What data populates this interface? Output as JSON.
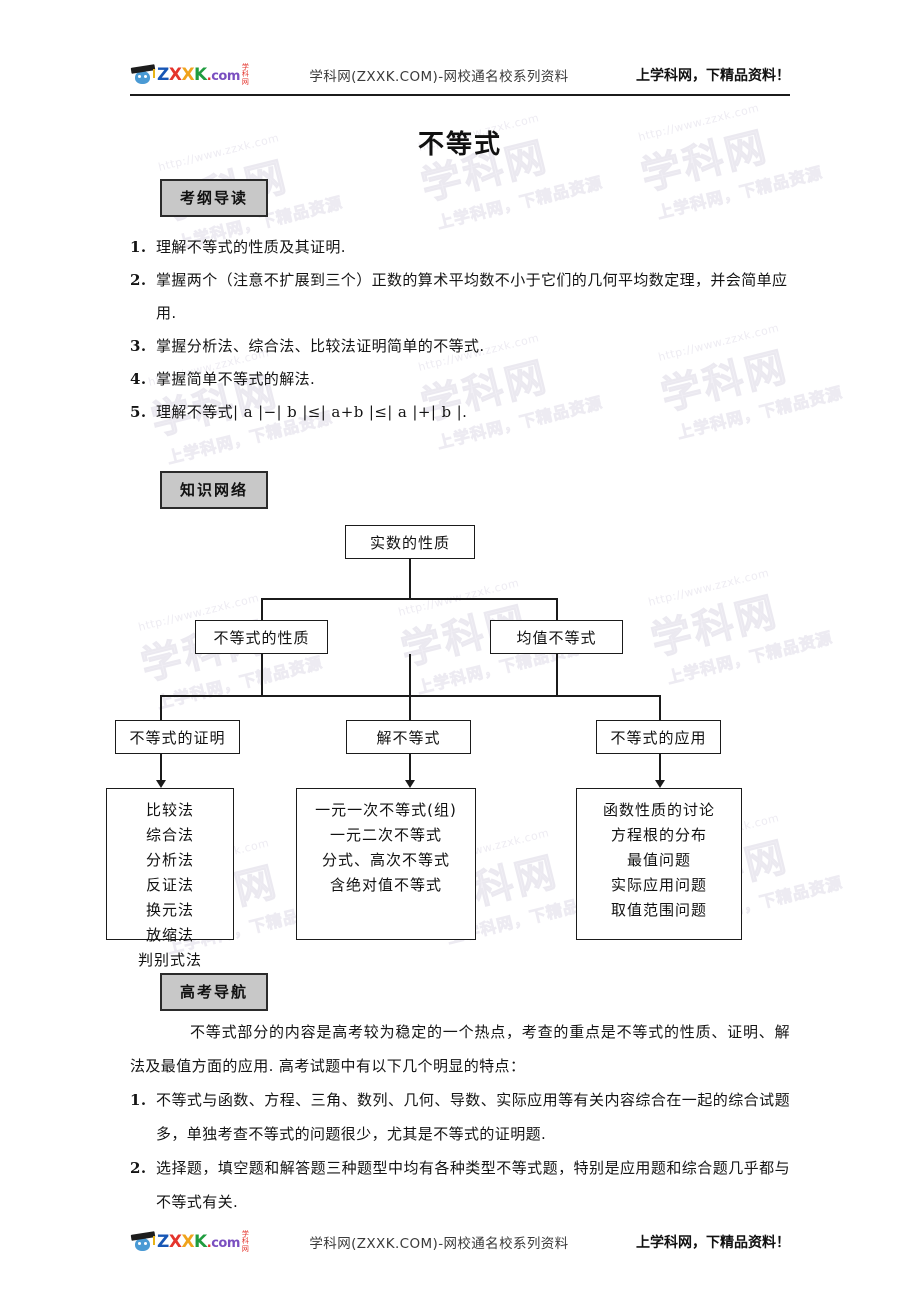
{
  "header": {
    "logo_alt": "zxxk-logo",
    "logo_text": "ZXXK",
    "logo_domain": ".com",
    "logo_cn": "学科网",
    "center": "学科网(ZXXK.COM)-网校通名校系列资料",
    "right": "上学科网，下精品资料！"
  },
  "footer": {
    "logo_alt": "zxxk-logo",
    "logo_text": "ZXXK",
    "logo_domain": ".com",
    "logo_cn": "学科网",
    "center": "学科网(ZXXK.COM)-网校通名校系列资料",
    "right": "上学科网，下精品资料！"
  },
  "document": {
    "title": "不等式"
  },
  "sections": {
    "outline": {
      "tag": "考纲导读",
      "items": [
        {
          "num": "1.",
          "text": "理解不等式的性质及其证明."
        },
        {
          "num": "2.",
          "text": "掌握两个（注意不扩展到三个）正数的算术平均数不小于它们的几何平均数定理，并会简单应用."
        },
        {
          "num": "3.",
          "text": "掌握分析法、综合法、比较法证明简单的不等式."
        },
        {
          "num": "4.",
          "text": "掌握简单不等式的解法."
        },
        {
          "num": "5.",
          "text": "理解不等式| a |−| b |≤| a+b |≤| a |+| b |."
        }
      ]
    },
    "knowledge": {
      "tag": "知识网络"
    },
    "navigation": {
      "tag": "高考导航",
      "intro": "不等式部分的内容是高考较为稳定的一个热点，考查的重点是不等式的性质、证明、解法及最值方面的应用. 高考试题中有以下几个明显的特点：",
      "points": [
        {
          "num": "1.",
          "text": "不等式与函数、方程、三角、数列、几何、导数、实际应用等有关内容综合在一起的综合试题多，单独考查不等式的问题很少，尤其是不等式的证明题."
        },
        {
          "num": "2.",
          "text": "选择题，填空题和解答题三种题型中均有各种类型不等式题，特别是应用题和综合题几乎都与不等式有关."
        }
      ]
    }
  },
  "flowchart": {
    "root": "实数的性质",
    "level2": [
      "不等式的性质",
      "均值不等式"
    ],
    "level3": [
      "不等式的证明",
      "解不等式",
      "不等式的应用"
    ],
    "level4": [
      {
        "lines": [
          "比较法",
          "综合法",
          "分析法",
          "反证法",
          "换元法",
          "放缩法",
          "判别式法"
        ]
      },
      {
        "lines": [
          "一元一次不等式(组)",
          "一元二次不等式",
          "分式、高次不等式",
          "含绝对值不等式"
        ]
      },
      {
        "lines": [
          "函数性质的讨论",
          "方程根的分布",
          "最值问题",
          "实际应用问题",
          "取值范围问题"
        ]
      }
    ]
  },
  "watermark": {
    "big": "学科网",
    "url": "http://www.zzxk.com",
    "slogan": "上学科网，下精品资源"
  },
  "colors": {
    "tag_fill": "#c8c8c8",
    "tag_border": "#2b2b2b",
    "rule": "#1b1b1b",
    "text": "#141414"
  }
}
